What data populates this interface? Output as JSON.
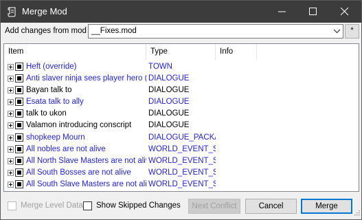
{
  "window": {
    "title": "Merge Mod"
  },
  "titlebar_icons": {
    "app": "scroll-icon",
    "minimize": "minimize-icon",
    "maximize": "maximize-icon",
    "close": "close-icon"
  },
  "mod": {
    "label": "Add changes from mod",
    "selected": "__Fixes.mod",
    "extra_button": "*"
  },
  "list": {
    "columns": [
      "Item",
      "Type",
      "Info"
    ],
    "rows": [
      {
        "item": "Heft (override)",
        "type": "TOWN",
        "color": "blue"
      },
      {
        "item": "Anti slaver ninja sees player hero (joi",
        "type": "DIALOGUE",
        "color": "blue"
      },
      {
        "item": "Bayan talk to",
        "type": "DIALOGUE",
        "color": "black"
      },
      {
        "item": "Esata talk to ally",
        "type": "DIALOGUE",
        "color": "blue"
      },
      {
        "item": "talk to ukon",
        "type": "DIALOGUE",
        "color": "black"
      },
      {
        "item": "Valamon introducing conscript",
        "type": "DIALOGUE",
        "color": "black"
      },
      {
        "item": "shopkeep Mourn",
        "type": "DIALOGUE_PACKA(",
        "color": "blue"
      },
      {
        "item": "All nobles are not alive",
        "type": "WORLD_EVENT_S'",
        "color": "blue"
      },
      {
        "item": "All North Slave Masters are not alive",
        "type": "WORLD_EVENT_S'",
        "color": "blue"
      },
      {
        "item": "All South Bosses are not alive",
        "type": "WORLD_EVENT_S'",
        "color": "blue"
      },
      {
        "item": "All South Slave Masters are not alive",
        "type": "WORLD_EVENT_S'",
        "color": "blue"
      }
    ]
  },
  "footer": {
    "merge_level_label": "Merge Level Data",
    "skipped_label": "Show Skipped Changes",
    "next_conflict_label": "Next Conflict",
    "cancel_label": "Cancel",
    "merge_label": "Merge"
  },
  "colors": {
    "titlebar": "#3c3c3c",
    "accent": "#0078d7",
    "link_blue": "#1f1fe8"
  }
}
